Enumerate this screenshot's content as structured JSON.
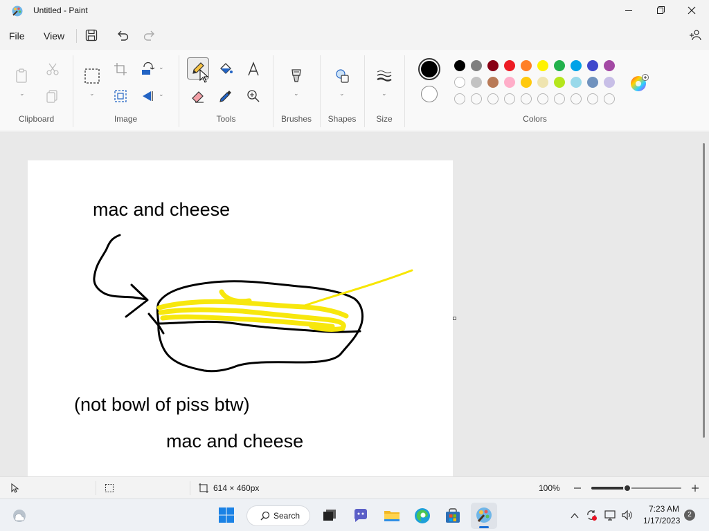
{
  "window": {
    "title": "Untitled - Paint"
  },
  "menu": {
    "file": "File",
    "view": "View"
  },
  "ribbon": {
    "clipboard_label": "Clipboard",
    "image_label": "Image",
    "tools_label": "Tools",
    "brushes_label": "Brushes",
    "shapes_label": "Shapes",
    "size_label": "Size",
    "colors_label": "Colors"
  },
  "colors": {
    "primary": "#000000",
    "secondary": "#ffffff",
    "palette_row1": [
      "#000000",
      "#7f7f7f",
      "#880015",
      "#ed1c24",
      "#ff7f27",
      "#fff200",
      "#22b14c",
      "#00a2e8",
      "#3f48cc",
      "#a349a4"
    ],
    "palette_row2": [
      "#ffffff",
      "#c3c3c3",
      "#b97a57",
      "#ffaec9",
      "#ffc90e",
      "#efe4b0",
      "#b5e61d",
      "#99d9ea",
      "#7092be",
      "#c8bfe7"
    ]
  },
  "canvas": {
    "texts": [
      "mac and cheese",
      "(not bowl of piss btw)",
      "mac and cheese"
    ]
  },
  "status": {
    "canvas_size": "614 × 460px",
    "zoom": "100%",
    "zoom_fraction": 0.4
  },
  "taskbar": {
    "search": "Search",
    "time": "7:23 AM",
    "date": "1/17/2023",
    "notifications": "2"
  }
}
